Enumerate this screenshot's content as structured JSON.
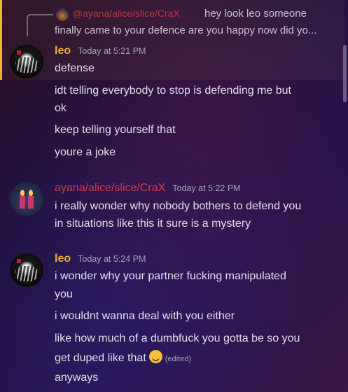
{
  "reply": {
    "author": "@ayana/alice/slice/CraX",
    "text_line1": "hey look leo someone",
    "text_line2": "finally came to your defence are you happy now did yo..."
  },
  "messages": [
    {
      "author": "leo",
      "timestamp": "Today at 5:21 PM",
      "lines": [
        "defense",
        "idt telling everybody to stop is defending me but",
        "ok",
        "keep telling yourself that",
        "youre a joke"
      ]
    },
    {
      "author": "ayana/alice/slice/CraX",
      "timestamp": "Today at 5:22 PM",
      "lines": [
        "i really wonder why nobody bothers to defend you",
        "in situations like this it sure is a mystery"
      ]
    },
    {
      "author": "leo",
      "timestamp": "Today at 5:24 PM",
      "lines": [
        "i wonder why your partner fucking manipulated",
        "you",
        "i wouldnt wanna deal with you either",
        "like how much of a dumbfuck you gotta be so you",
        "get duped like that",
        "anyways"
      ],
      "edited": "(edited)"
    }
  ],
  "colors": {
    "accent_leo": "#f0b232",
    "accent_ayana": "#d8384a"
  },
  "icons": {
    "emoji": "rolling-on-floor-laughing-emoji"
  }
}
